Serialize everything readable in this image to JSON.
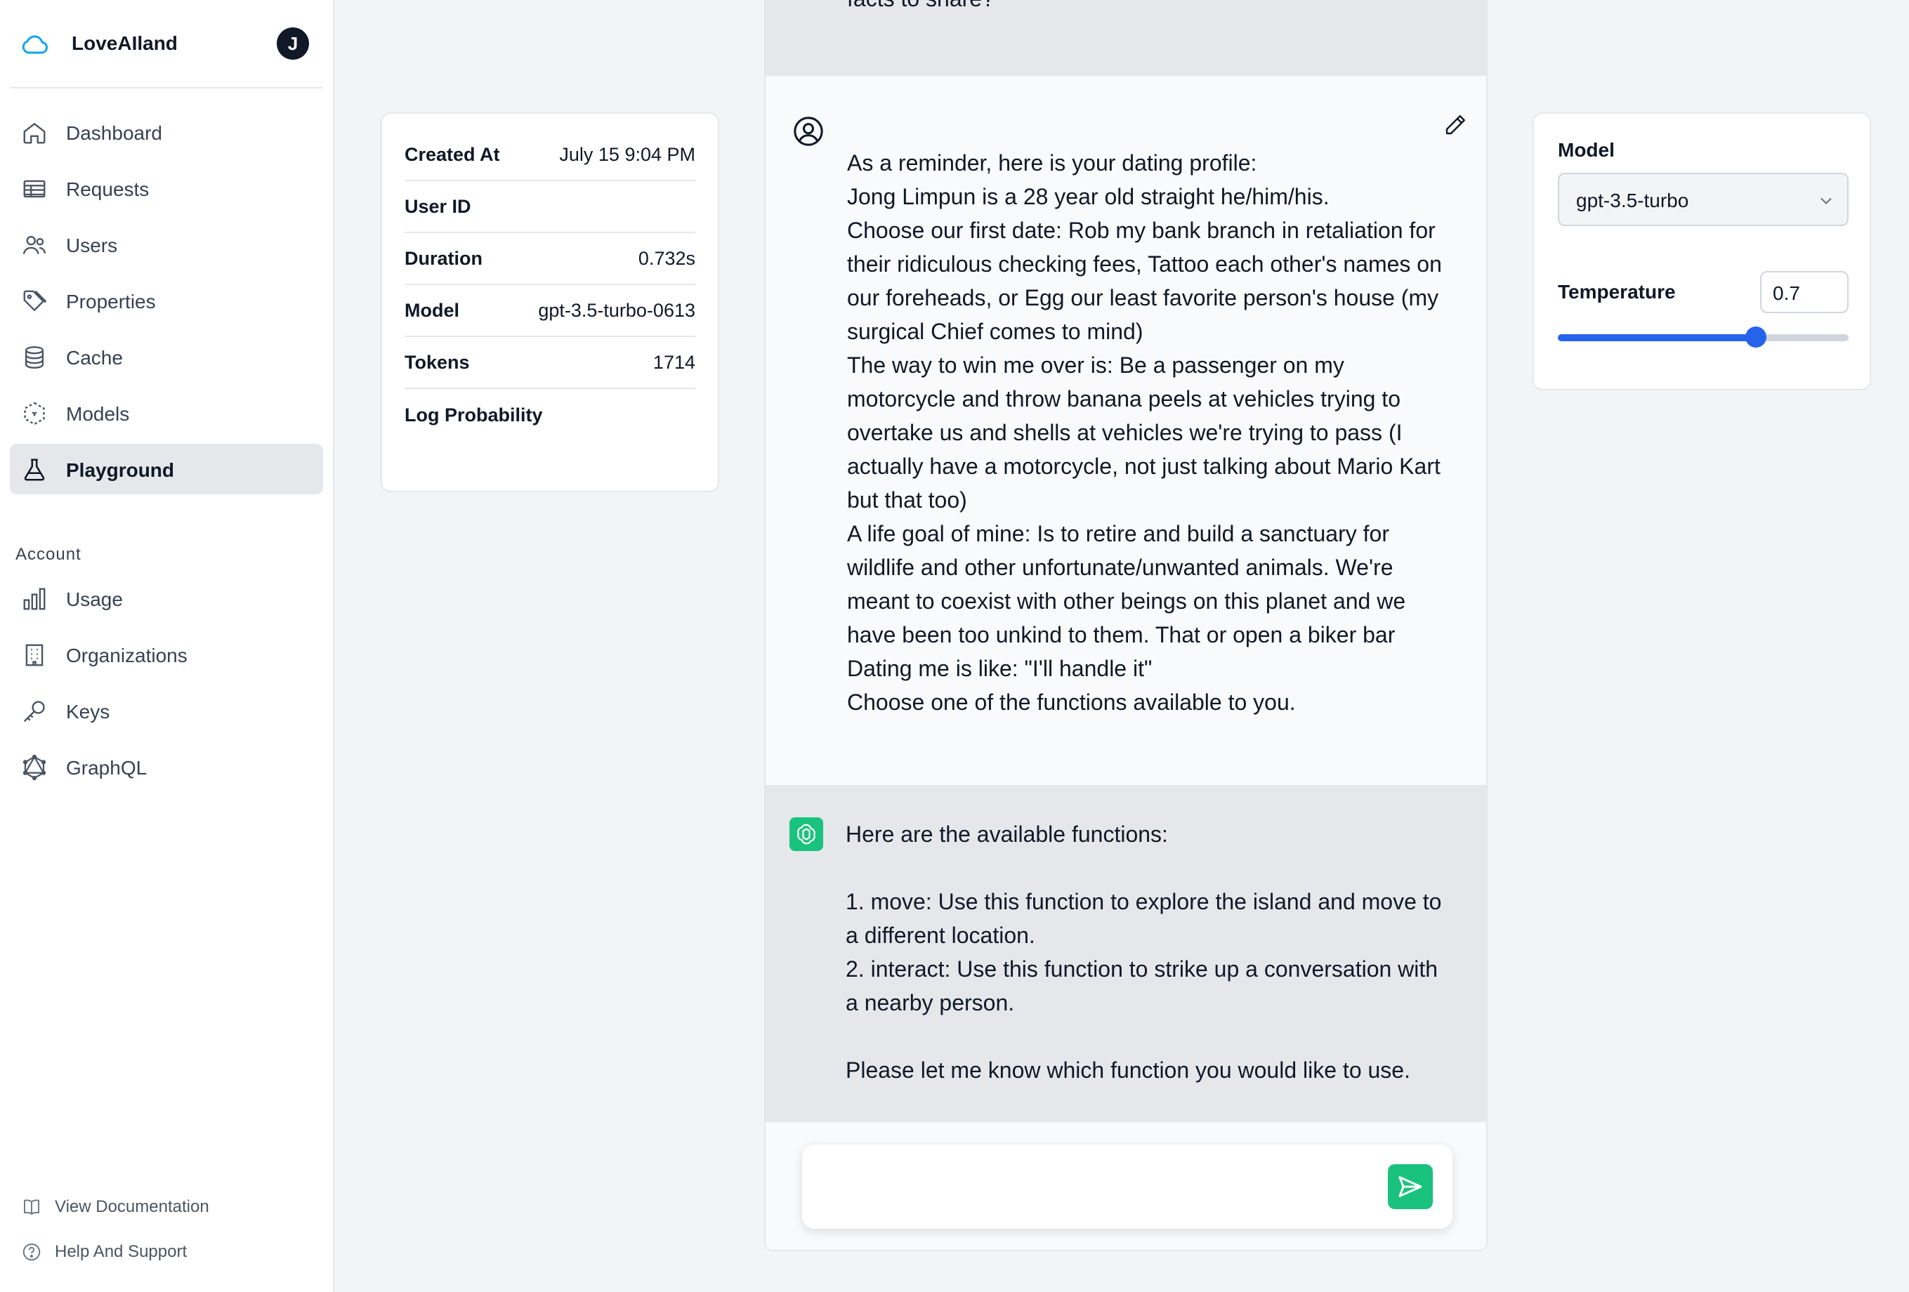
{
  "brand": {
    "name": "LoveAIland",
    "avatar_initial": "J"
  },
  "nav": [
    {
      "label": "Dashboard",
      "icon": "home-icon",
      "active": false
    },
    {
      "label": "Requests",
      "icon": "table-icon",
      "active": false
    },
    {
      "label": "Users",
      "icon": "users-icon",
      "active": false
    },
    {
      "label": "Properties",
      "icon": "tag-icon",
      "active": false
    },
    {
      "label": "Cache",
      "icon": "database-icon",
      "active": false
    },
    {
      "label": "Models",
      "icon": "cube-icon",
      "active": false
    },
    {
      "label": "Playground",
      "icon": "beaker-icon",
      "active": true
    }
  ],
  "account": {
    "label": "Account",
    "items": [
      {
        "label": "Usage",
        "icon": "bar-chart-icon"
      },
      {
        "label": "Organizations",
        "icon": "building-icon"
      },
      {
        "label": "Keys",
        "icon": "key-icon"
      },
      {
        "label": "GraphQL",
        "icon": "graphql-icon"
      }
    ]
  },
  "footer": {
    "docs": "View Documentation",
    "help": "Help And Support"
  },
  "info": [
    {
      "key": "Created At",
      "value": "July 15 9:04 PM"
    },
    {
      "key": "User ID",
      "value": ""
    },
    {
      "key": "Duration",
      "value": "0.732s"
    },
    {
      "key": "Model",
      "value": "gpt-3.5-turbo-0613"
    },
    {
      "key": "Tokens",
      "value": "1714"
    },
    {
      "key": "Log Probability",
      "value": ""
    }
  ],
  "chat": {
    "previous_tail": "facts to share?",
    "user_message": [
      "As a reminder, here is your dating profile:",
      "Jong Limpun is a 28 year old straight he/him/his.",
      "Choose our first date: Rob my bank branch in retaliation for",
      "their ridiculous checking fees, Tattoo each other's names on",
      "our foreheads, or Egg our least favorite person's house (my",
      "surgical Chief comes to mind)",
      "The way to win me over is: Be a passenger on my",
      "motorcycle and throw banana peels at vehicles trying to",
      "overtake us and shells at vehicles we're trying to pass (I",
      "actually have a motorcycle, not just talking about Mario Kart",
      "but that too)",
      "A life goal of mine: Is to retire and build a sanctuary for",
      "wildlife and other unfortunate/unwanted animals. We're",
      "meant to coexist with other beings on this planet and we",
      "have been too unkind to them. That or open a biker bar",
      "Dating me is like: \"I'll handle it\"",
      "Choose one of the functions available to you."
    ],
    "assistant_message": [
      "Here are the available functions:",
      "",
      "1. move: Use this function to explore the island and move to",
      "a different location.",
      "2. interact: Use this function to strike up a conversation with",
      "a nearby person.",
      "",
      "Please let me know which function you would like to use."
    ],
    "composer_placeholder": ""
  },
  "settings": {
    "model_label": "Model",
    "model_value": "gpt-3.5-turbo",
    "temperature_label": "Temperature",
    "temperature_value": "0.7",
    "temperature_fraction": 0.68
  },
  "colors": {
    "accent": "#2563eb",
    "assistant_green": "#19c37d",
    "brand_blue": "#0ea5e9"
  }
}
